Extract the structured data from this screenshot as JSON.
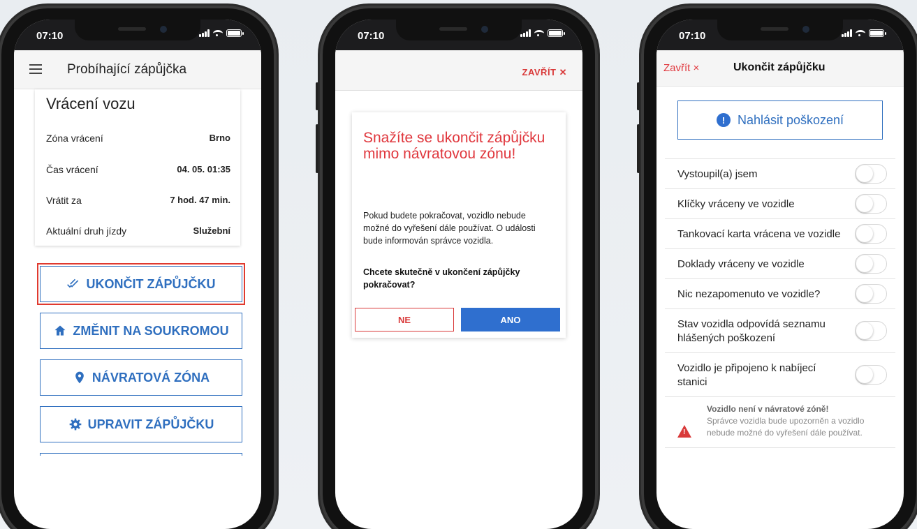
{
  "status_bar": {
    "time": "07:10"
  },
  "phone1": {
    "header_title": "Probíhající zápůjčka",
    "card_title": "Vrácení vozu",
    "rows": [
      {
        "label": "Zóna vrácení",
        "value": "Brno"
      },
      {
        "label": "Čas vrácení",
        "value": "04. 05. 01:35"
      },
      {
        "label": "Vrátit za",
        "value": "7 hod. 47 min."
      },
      {
        "label": "Aktuální druh jízdy",
        "value": "Služební"
      }
    ],
    "buttons": {
      "end": "UKONČIT ZÁPŮJČKU",
      "private": "ZMĚNIT NA SOUKROMOU",
      "zone": "NÁVRATOVÁ ZÓNA",
      "edit": "UPRAVIT ZÁPŮJČKU"
    }
  },
  "phone2": {
    "close_label": "ZAVŘÍT ✕",
    "dialog": {
      "title": "Snažíte se ukončit zápůjčku mimo návratovou zónu!",
      "body": "Pokud budete pokračovat, vozidlo nebude možné do vyřešení dále používat. O události bude informován správce vozidla.",
      "question": "Chcete skutečně v ukončení zápůjčky pokračovat?",
      "no_label": "NE",
      "yes_label": "ANO"
    }
  },
  "phone3": {
    "close_label": "Zavřít ×",
    "header_title": "Ukončit zápůjčku",
    "report_label": "Nahlásit poškození",
    "checklist": [
      "Vystoupil(a) jsem",
      "Klíčky vráceny ve vozidle",
      "Tankovací karta vrácena ve vozidle",
      "Doklady vráceny ve vozidle",
      "Nic nezapomenuto ve vozidle?",
      "Stav vozidla odpovídá seznamu hlášených poškození",
      "Vozidlo je připojeno k nabíjecí stanici"
    ],
    "warning": {
      "title": "Vozidlo není v návratové zóně!",
      "body": "Správce vozidla bude upozorněn a vozidlo nebude možné do vyřešení dále používat."
    }
  },
  "colors": {
    "accent": "#2f6fbf",
    "danger": "#e0373d"
  },
  "icons": [
    "menu-icon",
    "double-check-icon",
    "home-icon",
    "location-pin-icon",
    "gear-icon",
    "info-icon",
    "warning-icon",
    "close-icon"
  ]
}
